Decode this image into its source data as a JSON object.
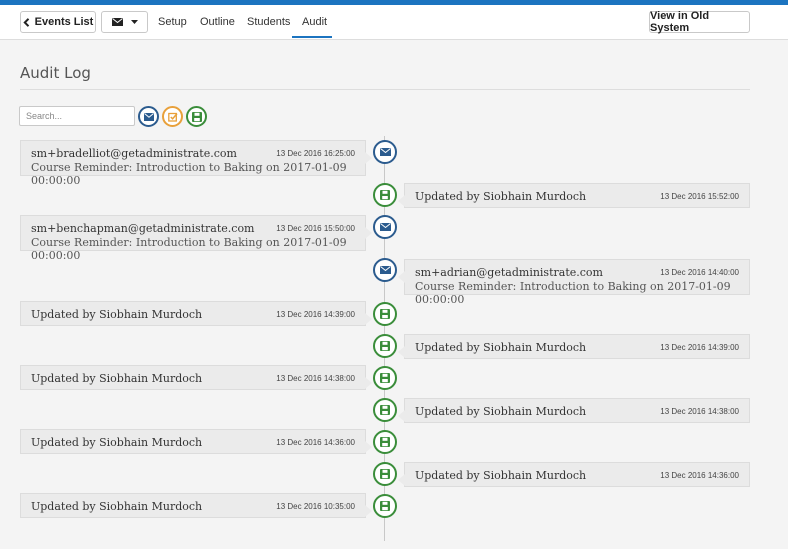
{
  "nav": {
    "events_list_label": "Events List",
    "setup": "Setup",
    "outline": "Outline",
    "students": "Students",
    "audit": "Audit",
    "old_system_label": "View in Old System"
  },
  "page": {
    "title": "Audit Log",
    "search_placeholder": "Search..."
  },
  "colors": {
    "accent": "#1c74c0",
    "mail": "#2b5b8e",
    "save": "#3a8d3a",
    "task": "#e8a03a"
  },
  "filters": [
    "mail-icon",
    "task-icon",
    "save-icon"
  ],
  "entries": [
    {
      "side": "left",
      "icon": "mail-icon",
      "main": "sm+bradelliot@getadministrate.com",
      "sub": "Course Reminder: Introduction to Baking on 2017-01-09 00:00:00",
      "ts": "13 Dec 2016 16:25:00"
    },
    {
      "side": "right",
      "icon": "save-icon",
      "main": "Updated by Siobhain Murdoch",
      "sub": "",
      "ts": "13 Dec 2016 15:52:00"
    },
    {
      "side": "left",
      "icon": "mail-icon",
      "main": "sm+benchapman@getadministrate.com",
      "sub": "Course Reminder: Introduction to Baking on 2017-01-09 00:00:00",
      "ts": "13 Dec 2016 15:50:00"
    },
    {
      "side": "right",
      "icon": "mail-icon",
      "main": "sm+adrian@getadministrate.com",
      "sub": "Course Reminder: Introduction to Baking on 2017-01-09 00:00:00",
      "ts": "13 Dec 2016 14:40:00"
    },
    {
      "side": "left",
      "icon": "save-icon",
      "main": "Updated by Siobhain Murdoch",
      "sub": "",
      "ts": "13 Dec 2016 14:39:00"
    },
    {
      "side": "right",
      "icon": "save-icon",
      "main": "Updated by Siobhain Murdoch",
      "sub": "",
      "ts": "13 Dec 2016 14:39:00"
    },
    {
      "side": "left",
      "icon": "save-icon",
      "main": "Updated by Siobhain Murdoch",
      "sub": "",
      "ts": "13 Dec 2016 14:38:00"
    },
    {
      "side": "right",
      "icon": "save-icon",
      "main": "Updated by Siobhain Murdoch",
      "sub": "",
      "ts": "13 Dec 2016 14:38:00"
    },
    {
      "side": "left",
      "icon": "save-icon",
      "main": "Updated by Siobhain Murdoch",
      "sub": "",
      "ts": "13 Dec 2016 14:36:00"
    },
    {
      "side": "right",
      "icon": "save-icon",
      "main": "Updated by Siobhain Murdoch",
      "sub": "",
      "ts": "13 Dec 2016 14:36:00"
    },
    {
      "side": "left",
      "icon": "save-icon",
      "main": "Updated by Siobhain Murdoch",
      "sub": "",
      "ts": "13 Dec 2016 10:35:00"
    }
  ]
}
